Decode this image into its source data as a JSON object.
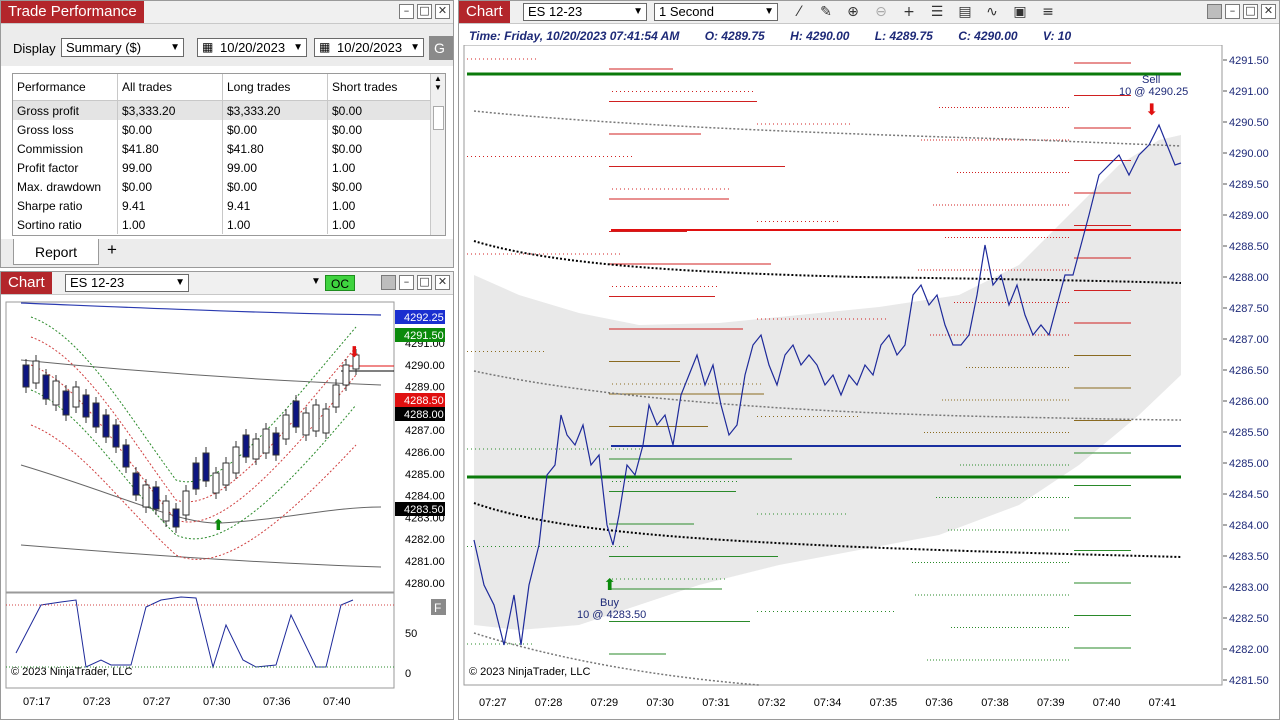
{
  "perf": {
    "title": "Trade Performance",
    "display_label": "Display",
    "display_value": "Summary ($)",
    "date_from": "10/20/2023",
    "date_to": "10/20/2023",
    "go_label": "G",
    "columns": [
      "Performance",
      "All trades",
      "Long trades",
      "Short trades"
    ],
    "rows": [
      [
        "Gross profit",
        "$3,333.20",
        "$3,333.20",
        "$0.00"
      ],
      [
        "Gross loss",
        "$0.00",
        "$0.00",
        "$0.00"
      ],
      [
        "Commission",
        "$41.80",
        "$41.80",
        "$0.00"
      ],
      [
        "Profit factor",
        "99.00",
        "99.00",
        "1.00"
      ],
      [
        "Max. drawdown",
        "$0.00",
        "$0.00",
        "$0.00"
      ],
      [
        "Sharpe ratio",
        "9.41",
        "9.41",
        "1.00"
      ],
      [
        "Sortino ratio",
        "1.00",
        "1.00",
        "1.00"
      ]
    ],
    "tab_report": "Report",
    "tab_add": "+"
  },
  "small_chart": {
    "title": "Chart",
    "instrument": "ES 12-23",
    "oc_label": "OC",
    "copyright": "© 2023 NinjaTrader, LLC",
    "price_ticks": [
      "4291.00",
      "4290.00",
      "4289.00",
      "4288.00",
      "4287.00",
      "4286.00",
      "4285.00",
      "4284.00",
      "4283.00",
      "4282.00",
      "4281.00",
      "4280.00"
    ],
    "price_badges": [
      {
        "text": "4292.25",
        "color": "#1a2fd0"
      },
      {
        "text": "4291.50",
        "color": "#0b8a0b"
      },
      {
        "text": "4288.50",
        "color": "#e01010"
      },
      {
        "text": "4288.00",
        "color": "#000000"
      },
      {
        "text": "4283.50",
        "color": "#000000"
      }
    ],
    "osc_ticks": [
      "50",
      "0"
    ],
    "time_ticks": [
      "07:17",
      "07:23",
      "07:27",
      "07:30",
      "07:36",
      "07:40"
    ],
    "f_label": "F"
  },
  "main_chart": {
    "title": "Chart",
    "instrument": "ES 12-23",
    "interval": "1 Second",
    "info": {
      "time": "Time: Friday, 10/20/2023 07:41:54 AM",
      "open": "O: 4289.75",
      "high": "H: 4290.00",
      "low": "L: 4289.75",
      "close": "C: 4290.00",
      "volume": "V: 10"
    },
    "price_ticks": [
      "4291.50",
      "4291.00",
      "4290.50",
      "4290.00",
      "4289.50",
      "4289.00",
      "4288.50",
      "4288.00",
      "4287.50",
      "4287.00",
      "4286.50",
      "4286.00",
      "4285.50",
      "4285.00",
      "4284.50",
      "4284.00",
      "4283.50",
      "4283.00",
      "4282.50",
      "4282.00",
      "4281.50"
    ],
    "time_ticks": [
      "07:27",
      "07:28",
      "07:29",
      "07:30",
      "07:31",
      "07:32",
      "07:34",
      "07:35",
      "07:36",
      "07:38",
      "07:39",
      "07:40",
      "07:41"
    ],
    "sell_label": "Sell",
    "sell_detail": "10 @ 4290.25",
    "buy_label": "Buy",
    "buy_detail": "10 @ 4283.50",
    "copyright": "© 2023 NinjaTrader, LLC"
  },
  "colors": {
    "title_red": "#b3262b",
    "price_line": "#1e2a9a",
    "oc_green": "#3fd33f"
  }
}
